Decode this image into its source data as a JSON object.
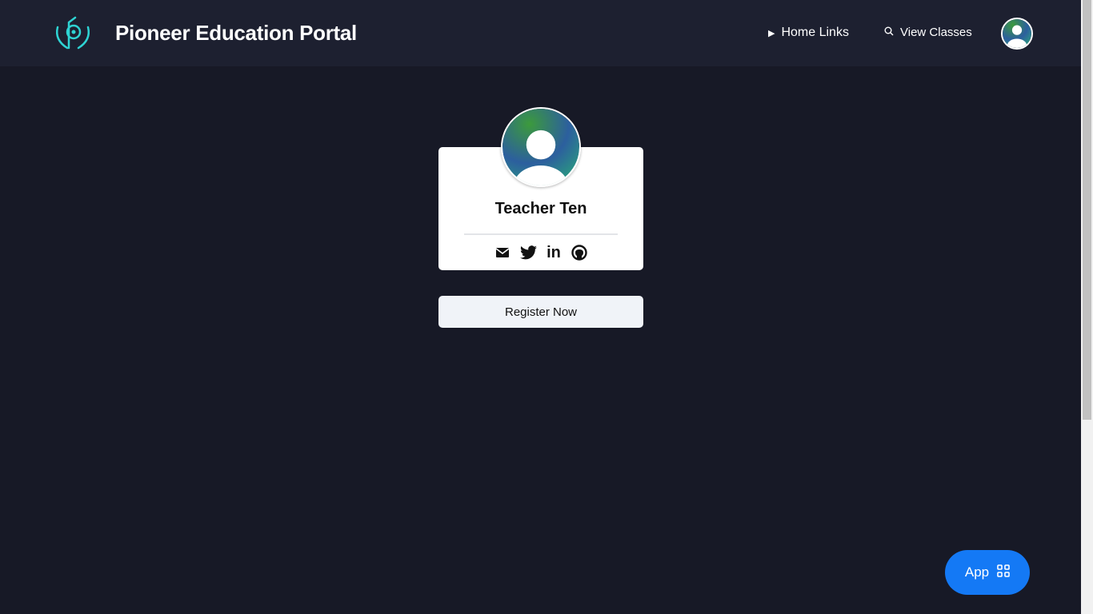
{
  "header": {
    "title": "Pioneer Education Portal",
    "nav": [
      {
        "label": "Home Links",
        "icon": "play-icon"
      },
      {
        "label": "View Classes",
        "icon": "search-icon"
      }
    ]
  },
  "profile": {
    "name": "Teacher Ten",
    "socials": [
      "email-icon",
      "twitter-icon",
      "linkedin-icon",
      "github-icon"
    ]
  },
  "register_label": "Register Now",
  "app_button_label": "App",
  "colors": {
    "accent": "#1479f5",
    "logo": "#2ed3d3"
  }
}
